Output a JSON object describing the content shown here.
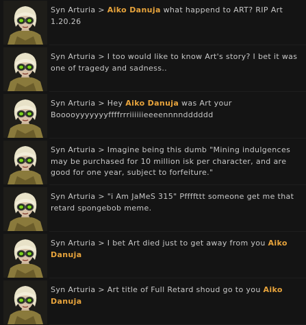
{
  "messages": [
    {
      "sender": "Syn Arturia",
      "sep": ">",
      "pre": "",
      "mention": "Aiko Danuja",
      "post": " what happend to ART? RIP Art 1.20.26"
    },
    {
      "sender": "Syn Arturia",
      "sep": ">",
      "pre": "I too would like to know Art's story? I bet it was one of tragedy and sadness..",
      "mention": "",
      "post": ""
    },
    {
      "sender": "Syn Arturia",
      "sep": ">",
      "pre": "Hey ",
      "mention": "Aiko Danuja",
      "post": " was Art your Booooyyyyyyyffffrrriiiiiieeeennnndddddd"
    },
    {
      "sender": "Syn Arturia",
      "sep": ">",
      "pre": "Imagine being this dumb \"Mining indulgences may be purchased for 10 million isk per character, and are good for one year, subject to forfeiture.\"",
      "mention": "",
      "post": ""
    },
    {
      "sender": "Syn Arturia",
      "sep": ">",
      "pre": "\"i Am JaMeS 315\" Pffffttt someone get me that retard spongebob meme.",
      "mention": "",
      "post": ""
    },
    {
      "sender": "Syn Arturia",
      "sep": ">",
      "pre": "I bet Art died just to get away from you ",
      "mention": "Aiko Danuja",
      "post": ""
    },
    {
      "sender": "Syn Arturia",
      "sep": ">",
      "pre": "Art title of Full Retard shoud go to you ",
      "mention": "Aiko Danuja",
      "post": ""
    }
  ],
  "colors": {
    "background": "#141414",
    "text": "#c8c8c8",
    "mention": "#e8a43c"
  },
  "icons": {
    "avatar": "character-portrait-blonde-goggles"
  }
}
